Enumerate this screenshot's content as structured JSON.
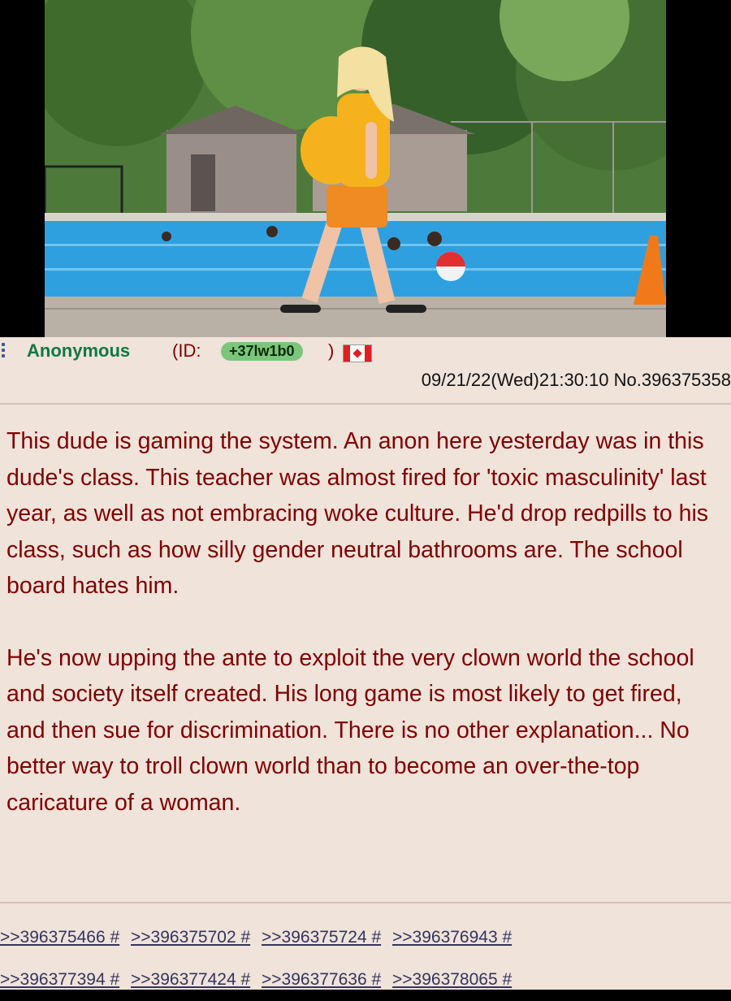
{
  "post": {
    "name": "Anonymous",
    "id_prefix": "(ID:",
    "id_value": "+37lw1b0",
    "id_suffix": ")",
    "flag": "flag-canada-icon",
    "datetime": "09/21/22(Wed)21:30:10",
    "post_no": "No.396375358",
    "paragraphs": [
      "This dude is gaming the system. An anon here yesterday was in this dude's class. This teacher was almost fired for 'toxic masculinity' last year, as well as not embracing woke culture. He'd drop redpills to his class, such as how silly gender neutral bathrooms are. The school board hates him.",
      "He's now upping the ante to exploit the very clown world the school and society itself created. His long game is most likely to get fired, and then sue for discrimination. There is no other explanation... No better way to troll clown world than to become an over-the-top caricature of a woman."
    ],
    "replies": [
      [
        ">>396375466 #",
        ">>396375702 #",
        ">>396375724 #",
        ">>396376943 #"
      ],
      [
        ">>396377394 #",
        ">>396377424 #",
        ">>396377636 #",
        ">>396378065 #"
      ]
    ]
  },
  "colors": {
    "post_bg": "#efe3da",
    "text": "#800000",
    "name": "#117743",
    "link": "#34345c",
    "id_badge": "#7bc67b"
  }
}
